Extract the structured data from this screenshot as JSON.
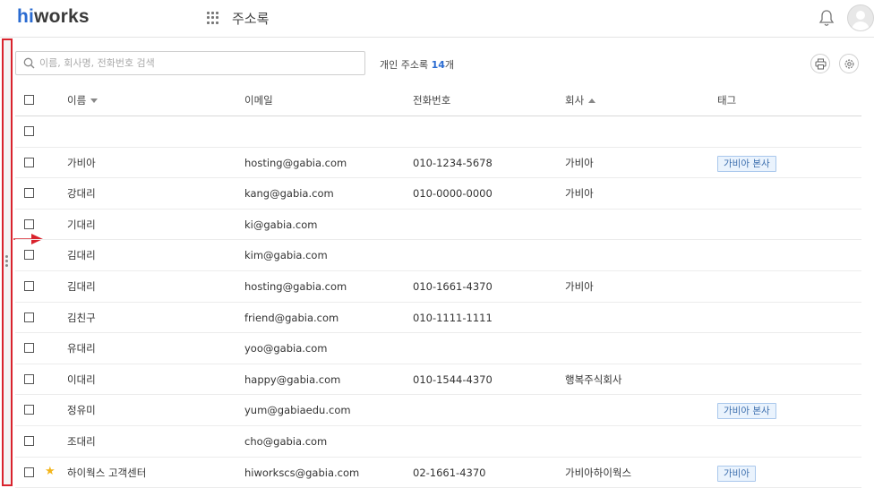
{
  "brand": {
    "logo_hi": "hi",
    "logo_rest": "works"
  },
  "header": {
    "app_title": "주소록"
  },
  "search": {
    "placeholder": "이름, 회사명, 전화번호 검색",
    "value": ""
  },
  "summary": {
    "label": "개인 주소록",
    "count": "14",
    "unit": "개"
  },
  "columns": {
    "name": "이름",
    "email": "이메일",
    "phone": "전화번호",
    "company": "회사",
    "tag": "태그"
  },
  "rows": [
    {
      "name": "",
      "email": "",
      "phone": "",
      "company": "",
      "tag": "",
      "starred": false
    },
    {
      "name": "가비아",
      "email": "hosting@gabia.com",
      "phone": "010-1234-5678",
      "company": "가비아",
      "tag": "가비아 본사",
      "starred": false
    },
    {
      "name": "강대리",
      "email": "kang@gabia.com",
      "phone": "010-0000-0000",
      "company": "가비아",
      "tag": "",
      "starred": false
    },
    {
      "name": "기대리",
      "email": "ki@gabia.com",
      "phone": "",
      "company": "",
      "tag": "",
      "starred": false
    },
    {
      "name": "김대리",
      "email": "kim@gabia.com",
      "phone": "",
      "company": "",
      "tag": "",
      "starred": false
    },
    {
      "name": "김대리",
      "email": "hosting@gabia.com",
      "phone": "010-1661-4370",
      "company": "가비아",
      "tag": "",
      "starred": false
    },
    {
      "name": "김친구",
      "email": "friend@gabia.com",
      "phone": "010-1111-1111",
      "company": "",
      "tag": "",
      "starred": false
    },
    {
      "name": "유대리",
      "email": "yoo@gabia.com",
      "phone": "",
      "company": "",
      "tag": "",
      "starred": false
    },
    {
      "name": "이대리",
      "email": "happy@gabia.com",
      "phone": "010-1544-4370",
      "company": "행복주식회사",
      "tag": "",
      "starred": false
    },
    {
      "name": "정유미",
      "email": "yum@gabiaedu.com",
      "phone": "",
      "company": "",
      "tag": "가비아 본사",
      "starred": false
    },
    {
      "name": "조대리",
      "email": "cho@gabia.com",
      "phone": "",
      "company": "",
      "tag": "",
      "starred": false
    },
    {
      "name": "하이웍스 고객센터",
      "email": "hiworkscs@gabia.com",
      "phone": "02-1661-4370",
      "company": "가비아하이웍스",
      "tag": "가비아",
      "starred": true
    }
  ],
  "icons": {
    "apps": "grid-icon",
    "notifications": "bell-icon",
    "profile": "avatar-icon",
    "print": "print-icon",
    "settings": "gear-icon",
    "search": "search-icon",
    "star": "star-icon"
  },
  "colors": {
    "brand_blue": "#2a6bd1",
    "highlight_red": "#d9232d",
    "star": "#f3b51b",
    "tag_border": "#a9c7ec"
  }
}
